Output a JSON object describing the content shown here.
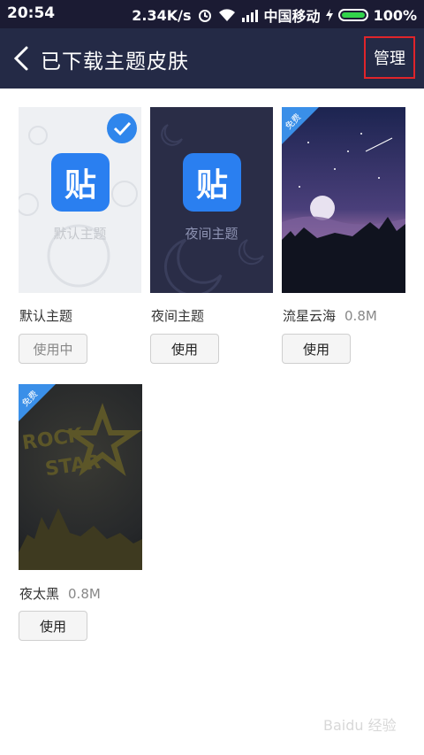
{
  "status_bar": {
    "time": "20:54",
    "speed": "2.34K/s",
    "carrier": "中国移动",
    "battery": "100%",
    "battery_color": "#32d44b"
  },
  "header": {
    "title": "已下载主题皮肤",
    "manage": "管理"
  },
  "themes": [
    {
      "thumb_text": "默认主题",
      "name": "默认主题",
      "size": "",
      "button": "使用中",
      "selected": true,
      "icon": "tieba-logo-icon"
    },
    {
      "thumb_text": "夜间主题",
      "name": "夜间主题",
      "size": "",
      "button": "使用",
      "icon": "tieba-logo-icon"
    },
    {
      "badge": "免费",
      "name": "流星云海",
      "size": "0.8M",
      "button": "使用"
    },
    {
      "badge": "免费",
      "name": "夜太黑",
      "size": "0.8M",
      "button": "使用",
      "art_text": [
        "ROCK",
        "STAR"
      ]
    }
  ],
  "logo_glyph": "贴",
  "watermark": "Baidu 经验",
  "colors": {
    "header_bg": "#242a46",
    "accent": "#2f86ec",
    "highlight_box": "#e0242a"
  }
}
